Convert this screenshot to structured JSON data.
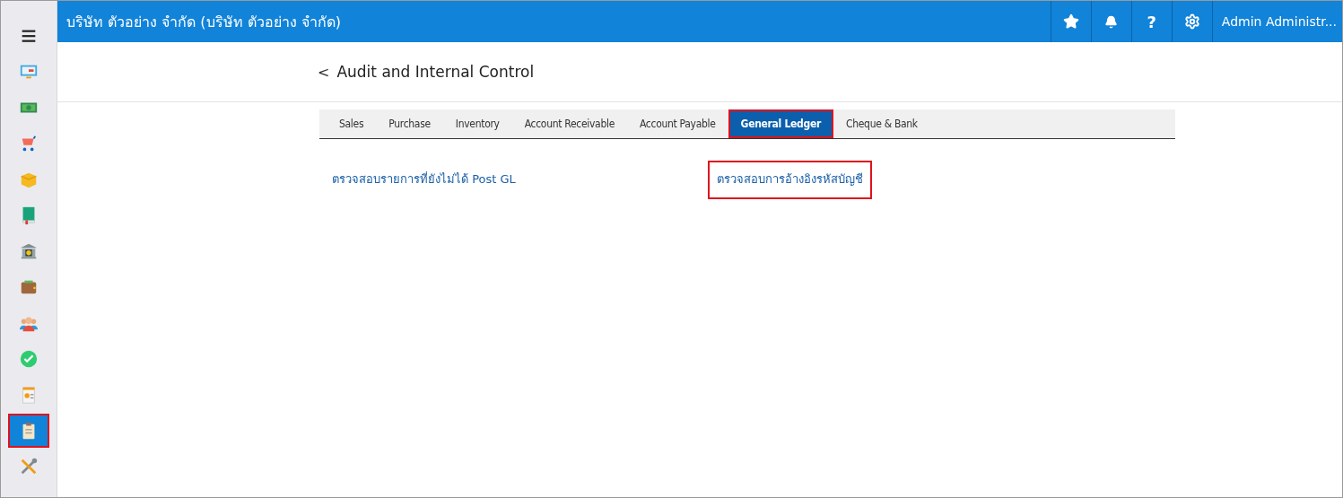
{
  "sidebar": {
    "items": [
      {
        "kind": "menu",
        "selected": false,
        "highlighted": false
      },
      {
        "kind": "monitor",
        "selected": false,
        "highlighted": false
      },
      {
        "kind": "money",
        "selected": false,
        "highlighted": false
      },
      {
        "kind": "cart",
        "selected": false,
        "highlighted": false
      },
      {
        "kind": "box",
        "selected": false,
        "highlighted": false
      },
      {
        "kind": "book",
        "selected": false,
        "highlighted": false
      },
      {
        "kind": "bank",
        "selected": false,
        "highlighted": false
      },
      {
        "kind": "wallet",
        "selected": false,
        "highlighted": false
      },
      {
        "kind": "people",
        "selected": false,
        "highlighted": false
      },
      {
        "kind": "check",
        "selected": false,
        "highlighted": false
      },
      {
        "kind": "invoice",
        "selected": false,
        "highlighted": false
      },
      {
        "kind": "clipboard",
        "selected": true,
        "highlighted": true
      },
      {
        "kind": "tools",
        "selected": false,
        "highlighted": false
      }
    ]
  },
  "header": {
    "title": "บริษัท ตัวอย่าง จำกัด (บริษัท ตัวอย่าง จำกัด)",
    "actions": [
      {
        "kind": "star"
      },
      {
        "kind": "bell"
      },
      {
        "kind": "help",
        "text": "?"
      },
      {
        "kind": "settings"
      }
    ],
    "user": "Admin Administr..."
  },
  "page": {
    "back": "<",
    "title": "Audit and Internal Control"
  },
  "tabs": [
    {
      "label": "Sales",
      "selected": false,
      "highlighted": false
    },
    {
      "label": "Purchase",
      "selected": false,
      "highlighted": false
    },
    {
      "label": "Inventory",
      "selected": false,
      "highlighted": false
    },
    {
      "label": "Account Receivable",
      "selected": false,
      "highlighted": false
    },
    {
      "label": "Account Payable",
      "selected": false,
      "highlighted": false
    },
    {
      "label": "General Ledger",
      "selected": true,
      "highlighted": true
    },
    {
      "label": "Cheque & Bank",
      "selected": false,
      "highlighted": false
    }
  ],
  "links": [
    {
      "label": "ตรวจสอบรายการที่ยังไม่ได้ Post GL",
      "highlighted": false
    },
    {
      "label": "ตรวจสอบการอ้างอิงรหัสบัญชี",
      "highlighted": true
    }
  ]
}
